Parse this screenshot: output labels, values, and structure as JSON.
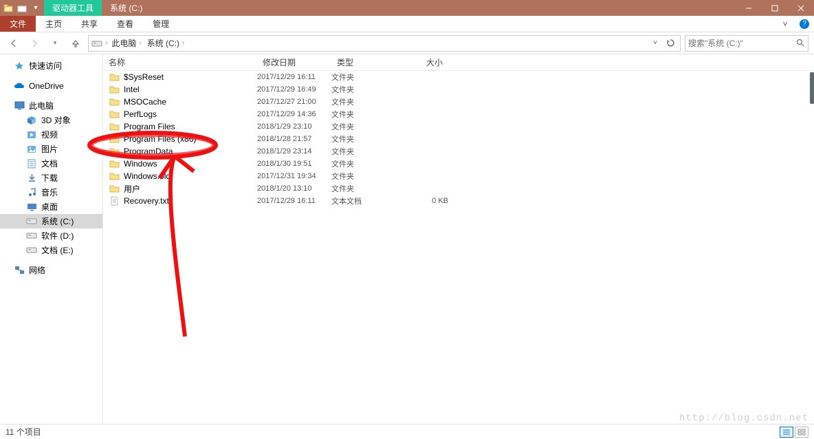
{
  "titlebar": {
    "tool_tab": "驱动器工具",
    "window_title": "系统 (C:)"
  },
  "ribbon": {
    "file": "文件",
    "tabs": [
      "主页",
      "共享",
      "查看",
      "管理"
    ]
  },
  "address": {
    "crumbs": [
      "此电脑",
      "系统 (C:)"
    ],
    "search_placeholder": "搜索\"系统 (C:)\""
  },
  "nav": {
    "quick_access": "快速访问",
    "onedrive": "OneDrive",
    "this_pc": "此电脑",
    "children": [
      {
        "label": "3D 对象",
        "icon": "cube"
      },
      {
        "label": "视频",
        "icon": "video"
      },
      {
        "label": "图片",
        "icon": "picture"
      },
      {
        "label": "文档",
        "icon": "doc"
      },
      {
        "label": "下载",
        "icon": "download"
      },
      {
        "label": "音乐",
        "icon": "music"
      },
      {
        "label": "桌面",
        "icon": "desktop"
      },
      {
        "label": "系统 (C:)",
        "icon": "drive",
        "selected": true
      },
      {
        "label": "软件 (D:)",
        "icon": "drive"
      },
      {
        "label": "文档 (E:)",
        "icon": "drive"
      }
    ],
    "network": "网络"
  },
  "columns": {
    "name": "名称",
    "date": "修改日期",
    "type": "类型",
    "size": "大小"
  },
  "rows": [
    {
      "icon": "folder",
      "name": "$SysReset",
      "date": "2017/12/29 16:11",
      "type": "文件夹",
      "size": ""
    },
    {
      "icon": "folder",
      "name": "Intel",
      "date": "2017/12/29 16:49",
      "type": "文件夹",
      "size": ""
    },
    {
      "icon": "folder",
      "name": "MSOCache",
      "date": "2017/12/27 21:00",
      "type": "文件夹",
      "size": ""
    },
    {
      "icon": "folder",
      "name": "PerfLogs",
      "date": "2017/12/29 14:36",
      "type": "文件夹",
      "size": ""
    },
    {
      "icon": "folder",
      "name": "Program Files",
      "date": "2018/1/29 23:10",
      "type": "文件夹",
      "size": ""
    },
    {
      "icon": "folder",
      "name": "Program Files (x86)",
      "date": "2018/1/28 21:57",
      "type": "文件夹",
      "size": ""
    },
    {
      "icon": "folder",
      "name": "ProgramData",
      "date": "2018/1/29 23:14",
      "type": "文件夹",
      "size": ""
    },
    {
      "icon": "folder",
      "name": "Windows",
      "date": "2018/1/30 19:51",
      "type": "文件夹",
      "size": ""
    },
    {
      "icon": "folder",
      "name": "Windows.old",
      "date": "2017/12/31 19:34",
      "type": "文件夹",
      "size": ""
    },
    {
      "icon": "folder",
      "name": "用户",
      "date": "2018/1/20 13:10",
      "type": "文件夹",
      "size": ""
    },
    {
      "icon": "file",
      "name": "Recovery.txt",
      "date": "2017/12/29 16:11",
      "type": "文本文档",
      "size": "0 KB"
    }
  ],
  "status": {
    "count": "11 个项目"
  },
  "watermark": "http://blog.csdn.net"
}
